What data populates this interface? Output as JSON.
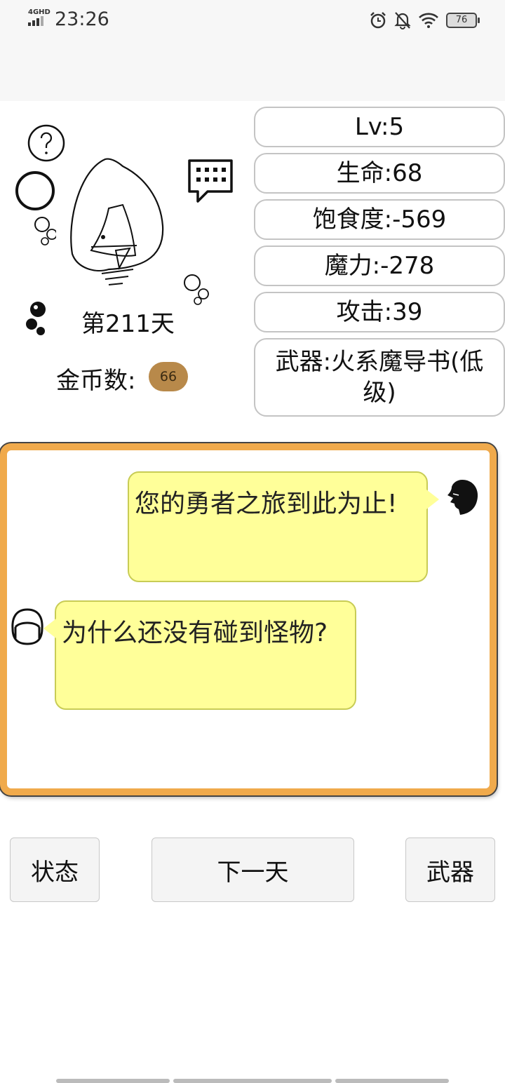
{
  "status_bar": {
    "network": "4GHD",
    "time": "23:26",
    "battery": "76",
    "icons": [
      "alarm-icon",
      "bell-muted-icon",
      "wifi-icon",
      "battery-icon"
    ]
  },
  "profile": {
    "day_text": "第211天",
    "coins_label": "金币数:",
    "coins_value": "66"
  },
  "stats": [
    {
      "text": "Lv:5"
    },
    {
      "text": "生命:68"
    },
    {
      "text": "饱食度:-569"
    },
    {
      "text": "魔力:-278"
    },
    {
      "text": "攻击:39"
    },
    {
      "text": "武器:火系魔导书(低级)"
    }
  ],
  "chat": {
    "messages": [
      {
        "side": "right",
        "text": "您的勇者之旅到此为止!"
      },
      {
        "side": "left",
        "text": "为什么还没有碰到怪物?"
      }
    ]
  },
  "buttons": {
    "status": "状态",
    "next_day": "下一天",
    "weapon": "武器"
  },
  "colors": {
    "chat_border": "#f0aa4c",
    "bubble": "#ffff99",
    "coin_badge": "#b8894a"
  }
}
